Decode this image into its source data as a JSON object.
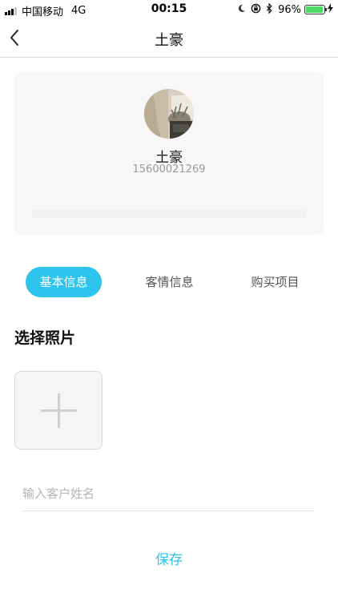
{
  "status_bar": {
    "carrier": "中国移动",
    "network": "4G",
    "time": "00:15",
    "battery_pct": "96%",
    "battery_level": 0.96,
    "battery_color": "#4cd964",
    "icons": [
      "moon-icon",
      "rotation-lock-icon",
      "bluetooth-icon",
      "charging-bolt-icon"
    ]
  },
  "nav": {
    "back_icon": "chevron-left-icon",
    "title": "土豪"
  },
  "profile": {
    "name": "土豪",
    "phone": "15600021269",
    "avatar": "avatar-photo"
  },
  "tabs": [
    {
      "label": "基本信息",
      "active": true
    },
    {
      "label": "客情信息",
      "active": false
    },
    {
      "label": "购买项目",
      "active": false
    }
  ],
  "photo_section": {
    "title": "选择照片",
    "add_icon": "plus-icon"
  },
  "form": {
    "name_placeholder": "输入客户姓名",
    "name_value": ""
  },
  "actions": {
    "save_label": "保存"
  },
  "colors": {
    "accent": "#2ec4ee",
    "card_bg": "#f7f7f7",
    "muted_text": "#9a9a9a"
  }
}
